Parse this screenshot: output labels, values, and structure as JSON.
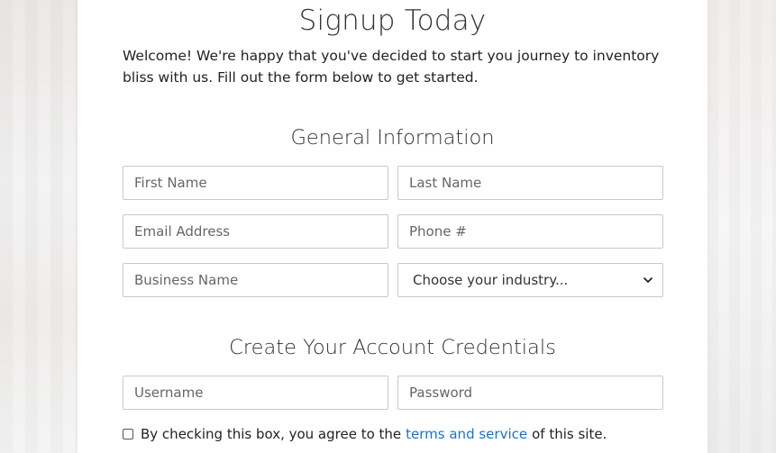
{
  "page": {
    "title": "Signup Today",
    "intro": "Welcome! We're happy that you've decided to start you journey to inventory bliss with us. Fill out the form below to get started."
  },
  "general": {
    "heading": "General Information",
    "first_name_placeholder": "First Name",
    "last_name_placeholder": "Last Name",
    "email_placeholder": "Email Address",
    "phone_placeholder": "Phone #",
    "business_placeholder": "Business Name",
    "industry_selected": "Choose your industry..."
  },
  "credentials": {
    "heading": "Create Your Account Credentials",
    "username_placeholder": "Username",
    "password_placeholder": "Password"
  },
  "agreement": {
    "prefix": "By checking this box, you agree to the",
    "link_text": "terms and service",
    "suffix": "of this site.",
    "checked": false
  },
  "icons": {
    "select_arrow": "chevron-down-icon",
    "agree_checkbox": "checkbox-icon"
  },
  "colors": {
    "link": "#1a73c9",
    "border": "#c9c9c9",
    "card": "#ffffff"
  }
}
